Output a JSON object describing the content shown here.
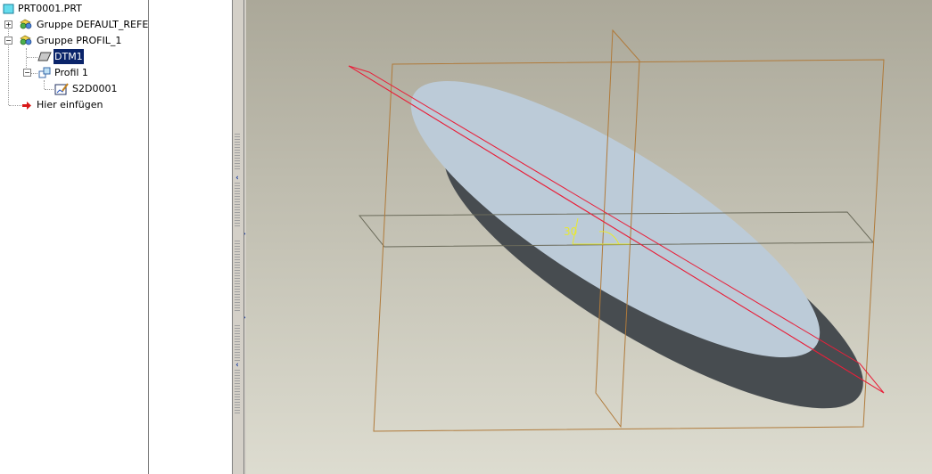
{
  "model_tree": {
    "items": [
      {
        "label": "PRT0001.PRT",
        "icon": "part-icon",
        "expander": "",
        "selected": false
      },
      {
        "label": "Gruppe DEFAULT_REFEF",
        "icon": "group-icon",
        "expander": "+",
        "selected": false
      },
      {
        "label": "Gruppe PROFIL_1",
        "icon": "group-icon",
        "expander": "−",
        "selected": false
      },
      {
        "label": "DTM1",
        "icon": "datum-plane-icon",
        "expander": "",
        "selected": true
      },
      {
        "label": "Profil 1",
        "icon": "profile-icon",
        "expander": "−",
        "selected": false
      },
      {
        "label": "S2D0001",
        "icon": "sketch-icon",
        "expander": "",
        "selected": false
      },
      {
        "label": "Hier einfügen",
        "icon": "insert-here-arrow-icon",
        "expander": "",
        "selected": false
      }
    ]
  },
  "splitter": {
    "arrows": [
      "‹",
      "›",
      "›",
      "‹"
    ]
  },
  "viewport": {
    "dimension_label": "30",
    "colors": {
      "background_top": "#aba899",
      "background_bottom": "#dddcd0",
      "surface": "#bccbd8",
      "edge_shadow": "#474c50",
      "datum_plane": "#b07a3a",
      "datum_plane_selected": "#e8203a",
      "default_plane": "#6a6a5a",
      "dimension": "#e8e832"
    }
  }
}
